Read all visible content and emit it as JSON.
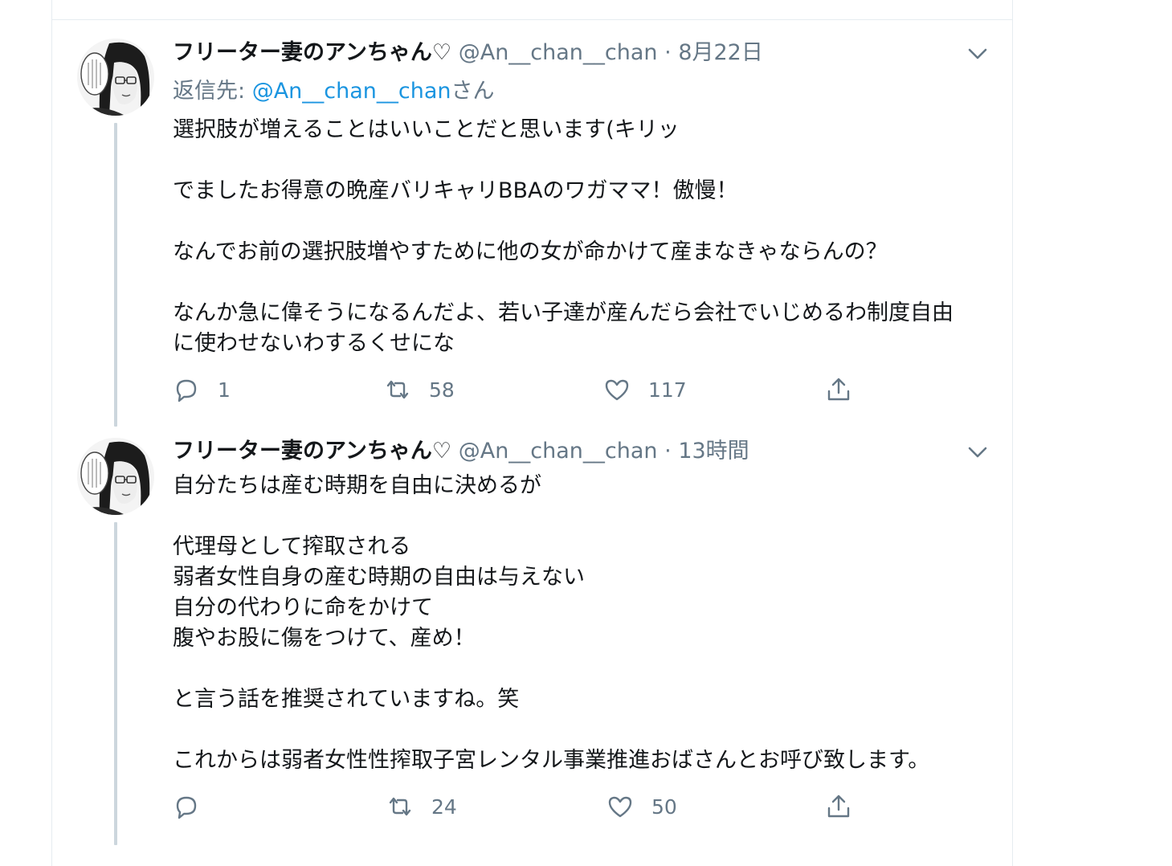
{
  "colors": {
    "text": "#14171a",
    "secondary": "#657786",
    "link": "#1b95e0",
    "border": "#e6ecf0",
    "thread": "#ccd6dd"
  },
  "tweets": [
    {
      "name": "フリーター妻のアンちゃん♡",
      "handle": "@An__chan__chan",
      "separator": "·",
      "time": "8月22日",
      "reply_prefix": "返信先: ",
      "reply_handle": "@An__chan__chan",
      "reply_suffix": "さん",
      "lines": [
        "選択肢が増えることはいいことだと思います(キリッ",
        "",
        "でましたお得意の晩産バリキャリBBAのワガママ！傲慢！",
        "",
        "なんでお前の選択肢増やすために他の女が命かけて産まなきゃならんの？",
        "",
        "なんか急に偉そうになるんだよ、若い子達が産んだら会社でいじめるわ制度自由",
        "に使わせないわするくせにな"
      ],
      "replies": "1",
      "retweets": "58",
      "likes": "117",
      "icons": {
        "reply": "reply-icon",
        "retweet": "retweet-icon",
        "like": "heart-icon",
        "share": "share-icon",
        "caret": "chevron-down-icon"
      }
    },
    {
      "name": "フリーター妻のアンちゃん♡",
      "handle": "@An__chan__chan",
      "separator": "·",
      "time": "13時間",
      "lines": [
        "自分たちは産む時期を自由に決めるが",
        "",
        "代理母として搾取される",
        "弱者女性自身の産む時期の自由は与えない",
        "自分の代わりに命をかけて",
        "腹やお股に傷をつけて、産め！",
        "",
        "と言う話を推奨されていますね。笑",
        "",
        "これからは弱者女性性搾取子宮レンタル事業推進おばさんとお呼び致します。"
      ],
      "replies": "",
      "retweets": "24",
      "likes": "50",
      "icons": {
        "reply": "reply-icon",
        "retweet": "retweet-icon",
        "like": "heart-icon",
        "share": "share-icon",
        "caret": "chevron-down-icon"
      }
    }
  ]
}
